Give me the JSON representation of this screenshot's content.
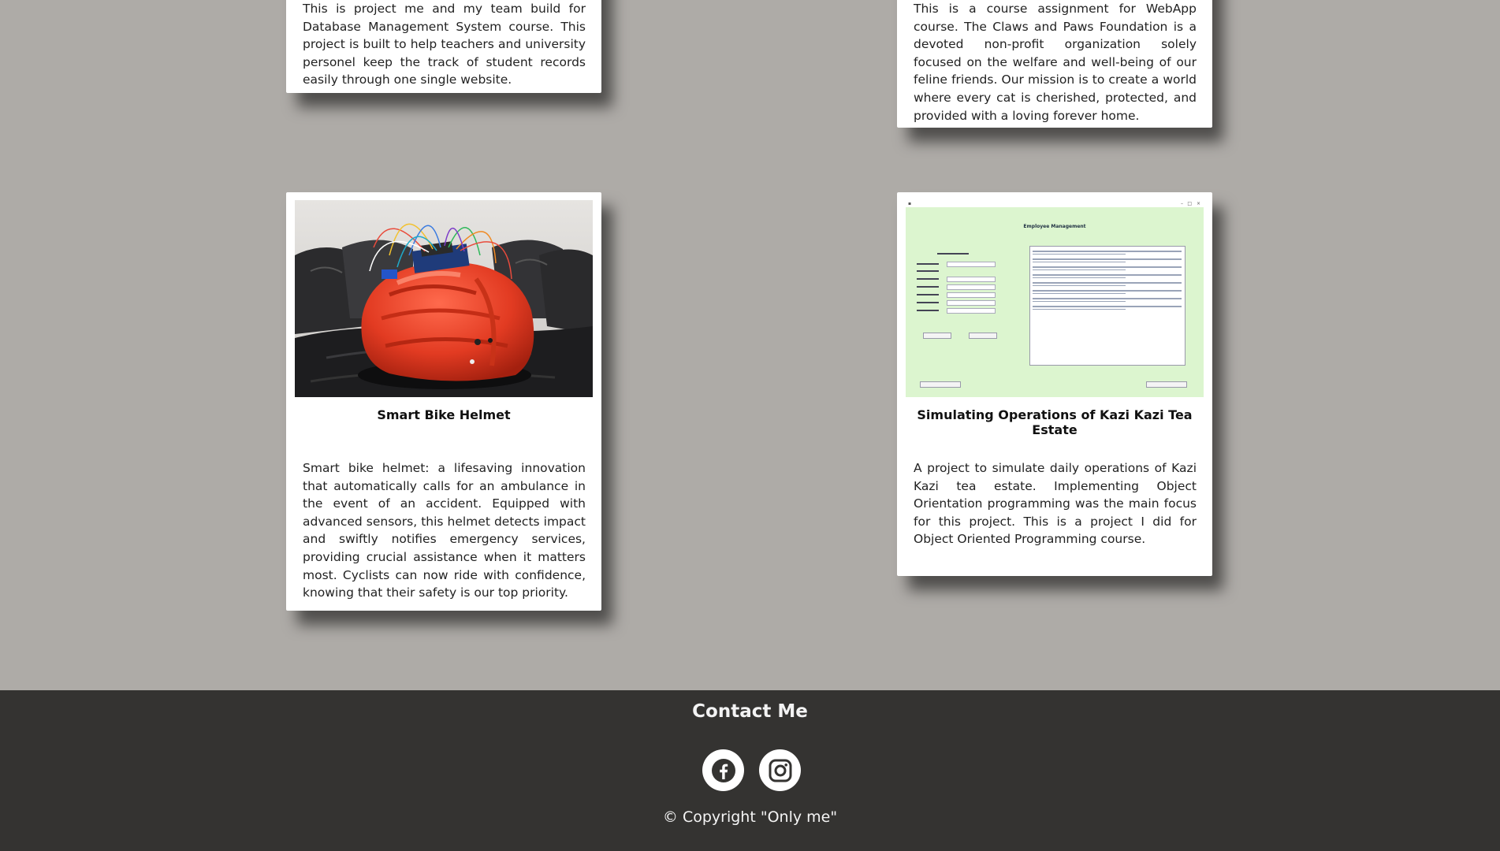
{
  "projects": {
    "database": {
      "description": "This is project me and my team build for Database Management System course. This project is built to help teachers and university personel keep the track of student records easily through one single website."
    },
    "paws": {
      "description": "This is a course assignment for WebApp course. The Claws and Paws Foundation is a devoted non-profit organization solely focused on the welfare and well-being of our feline friends. Our mission is to create a world where every cat is cherished, protected, and provided with a loving forever home."
    },
    "helmet": {
      "title": "Smart Bike Helmet",
      "description": "Smart bike helmet: a lifesaving innovation that automatically calls for an ambulance in the event of an accident. Equipped with advanced sensors, this helmet detects impact and swiftly notifies emergency services, providing crucial assistance when it matters most. Cyclists can now ride with confidence, knowing that their safety is our top priority."
    },
    "tea": {
      "title": "Simulating Operations of Kazi Kazi Tea Estate",
      "description": "A project to simulate daily operations of Kazi Kazi tea estate. Implementing Object Orientation programming was the main focus for this project. This is a project I did for Object Oriented Programming course.",
      "screenshot_title": "Employee Management"
    }
  },
  "footer": {
    "title": "Contact Me",
    "copyright": "© Copyright \"Only me\"",
    "facebook_icon": "facebook-icon",
    "instagram_icon": "instagram-icon"
  },
  "colors": {
    "page_background": "#aeaba7",
    "footer_background": "#343331",
    "card_background": "#ffffff"
  }
}
